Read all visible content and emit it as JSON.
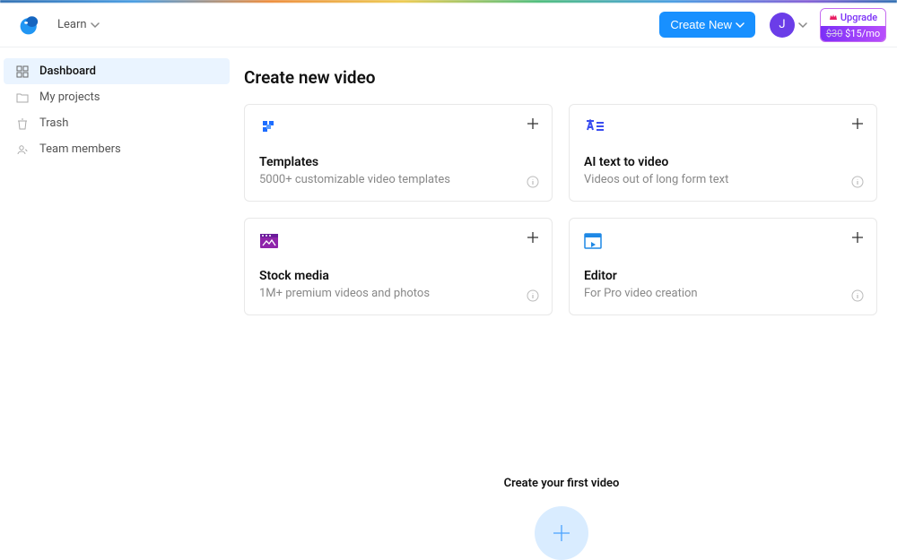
{
  "header": {
    "learn_label": "Learn",
    "create_label": "Create New",
    "avatar_initial": "J",
    "upgrade_label": "Upgrade",
    "upgrade_old_price": "$30",
    "upgrade_new_price": "$15/mo"
  },
  "sidebar": {
    "items": [
      {
        "label": "Dashboard"
      },
      {
        "label": "My projects"
      },
      {
        "label": "Trash"
      },
      {
        "label": "Team members"
      }
    ]
  },
  "main": {
    "heading": "Create new video",
    "cards": [
      {
        "title": "Templates",
        "subtitle": "5000+ customizable video templates"
      },
      {
        "title": "AI text to video",
        "subtitle": "Videos out of long form text"
      },
      {
        "title": "Stock media",
        "subtitle": "1M+ premium videos and photos"
      },
      {
        "title": "Editor",
        "subtitle": "For Pro video creation"
      }
    ],
    "first_video_title": "Create your first video"
  }
}
